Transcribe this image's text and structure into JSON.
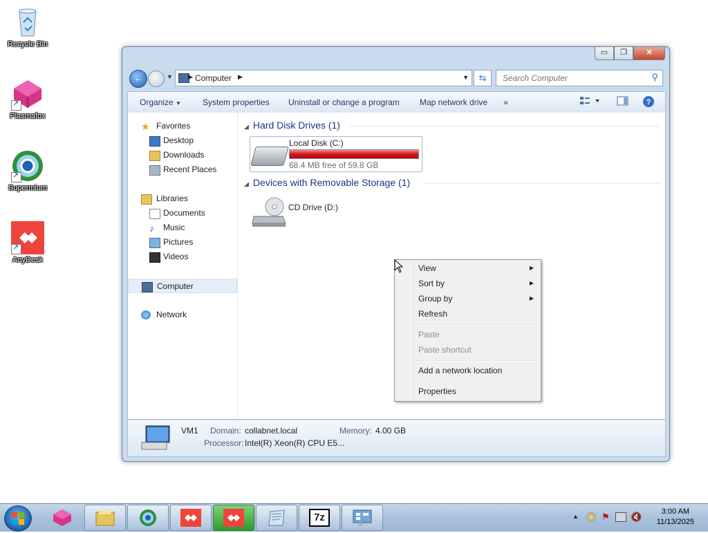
{
  "desktop": {
    "icons": [
      {
        "label": "Recycle Bin"
      },
      {
        "label": "Plasmafox"
      },
      {
        "label": "Supermium"
      },
      {
        "label": "AnyDesk"
      }
    ]
  },
  "window": {
    "controls": {
      "minimize": "▭",
      "maximize": "❐",
      "close": "✕"
    },
    "address": {
      "crumb": "Computer"
    },
    "search": {
      "placeholder": "Search Computer"
    },
    "toolbar": {
      "organize": "Organize",
      "system_properties": "System properties",
      "uninstall": "Uninstall or change a program",
      "map_drive": "Map network drive",
      "more": "»"
    },
    "nav": {
      "favorites": "Favorites",
      "desktop": "Desktop",
      "downloads": "Downloads",
      "recent": "Recent Places",
      "libraries": "Libraries",
      "documents": "Documents",
      "music": "Music",
      "pictures": "Pictures",
      "videos": "Videos",
      "computer": "Computer",
      "network": "Network"
    },
    "groups": {
      "hdd": "Hard Disk Drives (1)",
      "removable": "Devices with Removable Storage (1)"
    },
    "drives": {
      "c_name": "Local Disk (C:)",
      "c_free": "68.4 MB free of 59.8 GB",
      "c_used_fraction": 0.999,
      "d_name": "CD Drive (D:)"
    },
    "status": {
      "name": "VM1",
      "domain_label": "Domain:",
      "domain": "collabnet.local",
      "memory_label": "Memory:",
      "memory": "4.00 GB",
      "processor_label": "Processor:",
      "processor": "Intel(R) Xeon(R) CPU E5..."
    }
  },
  "context_menu": {
    "view": "View",
    "sort_by": "Sort by",
    "group_by": "Group by",
    "refresh": "Refresh",
    "paste": "Paste",
    "paste_shortcut": "Paste shortcut",
    "add_network_location": "Add a network location",
    "properties": "Properties"
  },
  "taskbar": {
    "time": "3:00 AM",
    "date": "11/13/2025",
    "sevenzip": "7z"
  },
  "colors": {
    "drive_bar": "#d0161c",
    "group_header": "#1e3287",
    "taskbar_active": "#2c9c2a"
  }
}
